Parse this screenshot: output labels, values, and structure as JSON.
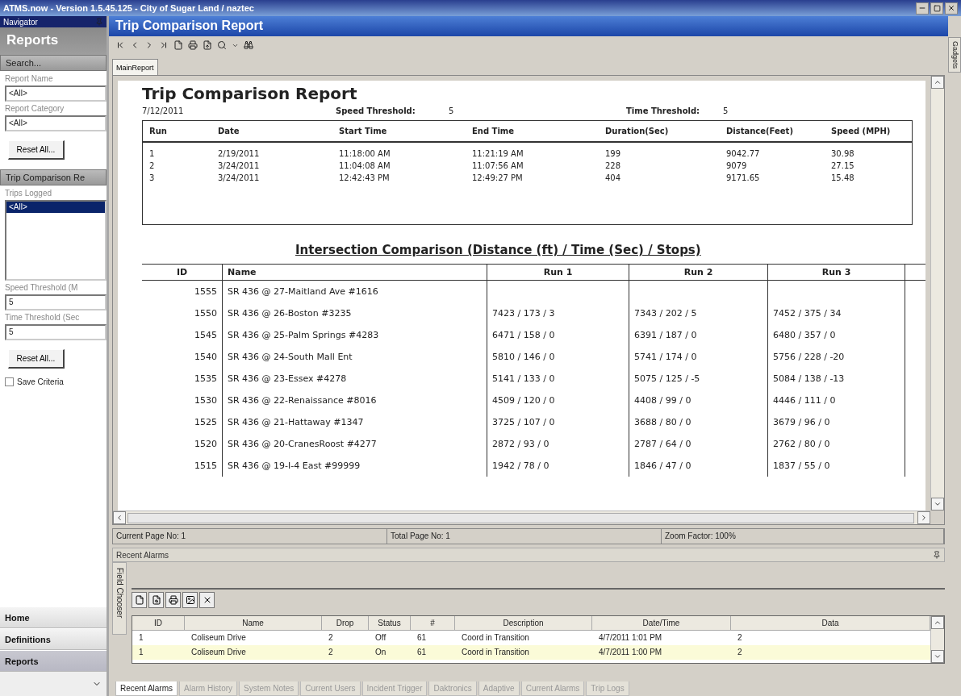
{
  "window": {
    "title": "ATMS.now - Version 1.5.45.125 - City of Sugar Land / naztec"
  },
  "navigator": {
    "title": "Navigator",
    "header": "Reports",
    "search_button": "Search...",
    "fields": [
      {
        "label": "Report Name",
        "value": "<All>"
      },
      {
        "label": "Report Category",
        "value": "<All>"
      }
    ],
    "reset_button": "Reset All...",
    "section": "Trip Comparison Re",
    "trips_label": "Trips Logged",
    "trips": [
      {
        "label": "<All>",
        "selected": true
      }
    ],
    "thresholds": [
      {
        "label": "Speed Threshold (M",
        "value": "5"
      },
      {
        "label": "Time Threshold (Sec",
        "value": "5"
      }
    ],
    "reset_button_2": "Reset All...",
    "save_criteria": {
      "label": "Save Criteria",
      "checked": false
    },
    "nav_buttons": [
      {
        "label": "Home",
        "selected": false
      },
      {
        "label": "Definitions",
        "selected": false
      },
      {
        "label": "Reports",
        "selected": true
      }
    ]
  },
  "panel": {
    "title": "Trip Comparison Report",
    "tabs": [
      {
        "label": "MainReport",
        "selected": true
      }
    ]
  },
  "report": {
    "title": "Trip Comparison Report",
    "date": "7/12/2011",
    "speed_threshold": {
      "label": "Speed Threshold:",
      "value": "5"
    },
    "time_threshold": {
      "label": "Time Threshold:",
      "value": "5"
    },
    "runs": {
      "columns": [
        "Run",
        "Date",
        "Start Time",
        "End Time",
        "Duration(Sec)",
        "Distance(Feet)",
        "Speed (MPH)"
      ],
      "rows": [
        [
          "1",
          "2/19/2011",
          "11:18:00 AM",
          "11:21:19 AM",
          "199",
          "9042.77",
          "30.98"
        ],
        [
          "2",
          "3/24/2011",
          "11:04:08 AM",
          "11:07:56 AM",
          "228",
          "9079",
          "27.15"
        ],
        [
          "3",
          "3/24/2011",
          "12:42:43 PM",
          "12:49:27 PM",
          "404",
          "9171.65",
          "15.48"
        ]
      ]
    },
    "intersection_title": "Intersection  Comparison (Distance (ft) / Time (Sec) / Stops)",
    "intersections": {
      "columns": [
        "ID",
        "Name",
        "Run 1",
        "Run 2",
        "Run 3"
      ],
      "rows": [
        [
          "1555",
          "SR 436 @ 27-Maitland Ave #1616",
          "",
          "",
          ""
        ],
        [
          "1550",
          "SR 436 @ 26-Boston #3235",
          "7423 / 173 / 3",
          "7343 / 202 / 5",
          "7452 / 375 / 34"
        ],
        [
          "1545",
          "SR 436 @ 25-Palm Springs #4283",
          "6471 / 158 / 0",
          "6391 / 187 / 0",
          "6480 / 357 / 0"
        ],
        [
          "1540",
          "SR 436 @ 24-South Mall Ent",
          "5810 / 146 / 0",
          "5741 / 174 / 0",
          "5756 / 228 / -20"
        ],
        [
          "1535",
          "SR 436 @ 23-Essex #4278",
          "5141 / 133 / 0",
          "5075 / 125 / -5",
          "5084 / 138 / -13"
        ],
        [
          "1530",
          "SR 436 @ 22-Renaissance #8016",
          "4509 / 120 / 0",
          "4408 / 99 / 0",
          "4446 / 111 / 0"
        ],
        [
          "1525",
          "SR 436 @ 21-Hattaway #1347",
          "3725 / 107 / 0",
          "3688 / 80 / 0",
          "3679 / 96 / 0"
        ],
        [
          "1520",
          "SR 436 @ 20-CranesRoost #4277",
          "2872 / 93 / 0",
          "2787 / 64 / 0",
          "2762 / 80 / 0"
        ],
        [
          "1515",
          "SR 436 @ 19-I-4 East #99999",
          "1942 / 78 / 0",
          "1846 / 47 / 0",
          "1837 / 55 / 0"
        ]
      ]
    }
  },
  "status_bar": [
    "Current Page No: 1",
    "Total Page No: 1",
    "Zoom Factor: 100%"
  ],
  "alarms": {
    "title": "Recent Alarms",
    "field_chooser": "Field Chooser",
    "columns": [
      "ID",
      "Name",
      "Drop",
      "Status",
      "#",
      "Description",
      "Date/Time",
      "Data"
    ],
    "rows": [
      {
        "cells": [
          "1",
          "Coliseum Drive",
          "2",
          "Off",
          "61",
          "Coord in Transition",
          "4/7/2011 1:01 PM",
          "2"
        ],
        "selected": false
      },
      {
        "cells": [
          "1",
          "Coliseum Drive",
          "2",
          "On",
          "61",
          "Coord in Transition",
          "4/7/2011 1:00 PM",
          "2"
        ],
        "selected": true
      }
    ]
  },
  "bottom_tabs": [
    {
      "label": "Recent Alarms",
      "selected": true
    },
    {
      "label": "Alarm History",
      "selected": false
    },
    {
      "label": "System Notes",
      "selected": false
    },
    {
      "label": "Current Users",
      "selected": false
    },
    {
      "label": "Incident Trigger",
      "selected": false
    },
    {
      "label": "Daktronics",
      "selected": false
    },
    {
      "label": "Adaptive",
      "selected": false
    },
    {
      "label": "Current Alarms",
      "selected": false
    },
    {
      "label": "Trip Logs",
      "selected": false
    }
  ],
  "gadgets_tab": "Gadgets"
}
